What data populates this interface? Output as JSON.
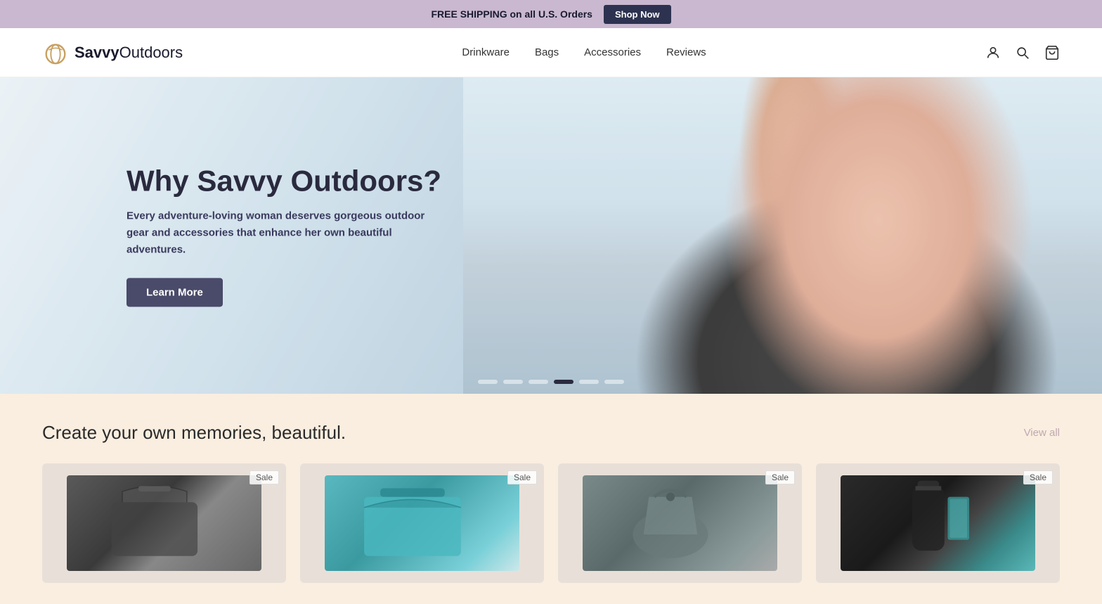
{
  "announcement": {
    "text": "FREE SHIPPING on all U.S. Orders",
    "cta_label": "Shop Now"
  },
  "header": {
    "logo_text_bold": "Savvy",
    "logo_text_light": "Outdoors",
    "nav_links": [
      {
        "label": "Drinkware",
        "href": "#"
      },
      {
        "label": "Bags",
        "href": "#"
      },
      {
        "label": "Accessories",
        "href": "#"
      },
      {
        "label": "Reviews",
        "href": "#"
      }
    ],
    "icons": {
      "account": "account-icon",
      "search": "search-icon",
      "cart": "cart-icon"
    }
  },
  "hero": {
    "title": "Why Savvy Outdoors?",
    "subtitle": "Every adventure-loving woman deserves gorgeous outdoor gear and accessories that enhance her own beautiful adventures.",
    "cta_label": "Learn More",
    "dots": [
      "inactive",
      "inactive",
      "inactive",
      "active",
      "inactive",
      "inactive"
    ]
  },
  "products_section": {
    "title": "Create your own memories, beautiful.",
    "view_all_label": "View all",
    "products": [
      {
        "sale": true,
        "sale_label": "Sale"
      },
      {
        "sale": true,
        "sale_label": "Sale"
      },
      {
        "sale": true,
        "sale_label": "Sale"
      },
      {
        "sale": true,
        "sale_label": "Sale"
      }
    ]
  }
}
